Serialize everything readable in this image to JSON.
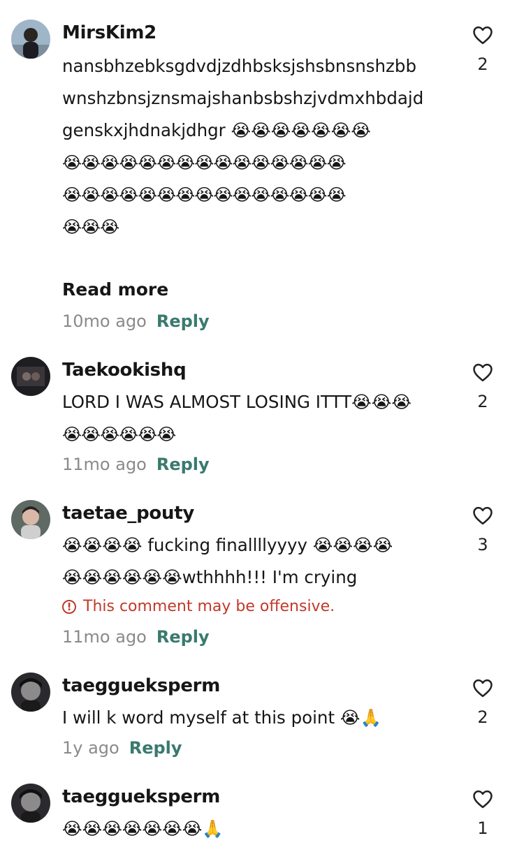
{
  "comments": [
    {
      "username": "MirsKim2",
      "lines": [
        "nansbhzebksgdvdjzdhbsksjshsbnsnshzbb",
        "wnshzbnsjznsmajshanbsbshzjvdmxhbdajd",
        "genskxjhdnakjdhgr 😭😭😭😭😭😭😭",
        "😭😭😭😭😭😭😭😭😭😭😭😭😭😭😭",
        "😭😭😭😭😭😭😭😭😭😭😭😭😭😭😭",
        "😭😭😭"
      ],
      "read_more": "Read more",
      "time": "10mo ago",
      "reply": "Reply",
      "likes": "2"
    },
    {
      "username": "Taekookishq",
      "lines": [
        "LORD I WAS ALMOST LOSING ITTT😭😭😭",
        "😭😭😭😭😭😭"
      ],
      "time": "11mo ago",
      "reply": "Reply",
      "likes": "2"
    },
    {
      "username": "taetae_pouty",
      "lines": [
        "😭😭😭😭 fucking finallllyyyy 😭😭😭😭",
        "😭😭😭😭😭😭wthhhh!!! I'm crying"
      ],
      "warning": "This comment may be offensive.",
      "time": "11mo ago",
      "reply": "Reply",
      "likes": "3"
    },
    {
      "username": "taeggueksperm",
      "lines": [
        "I will k word myself at this point 😭🙏"
      ],
      "time": "1y ago",
      "reply": "Reply",
      "likes": "2"
    },
    {
      "username": "taeggueksperm",
      "lines": [
        "😭😭😭😭😭😭😭🙏"
      ],
      "likes": "1"
    }
  ],
  "icons": {
    "like": "heart-outline-icon",
    "warning": "exclamation-circle-icon"
  },
  "colors": {
    "reply": "#3a7a6e",
    "warning": "#c0392b",
    "time": "#8a8a8a"
  }
}
